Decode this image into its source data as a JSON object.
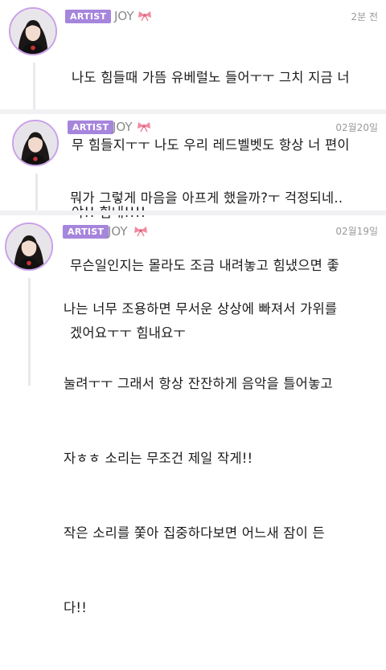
{
  "comments": [
    {
      "badge": "ARTIST",
      "name": "JOY",
      "time": "2분 전",
      "lines": [
        "나도 힘들때 가뜸 유베럴노 들어ㅜㅜ 그치 지금 너",
        "무 힘들지ㅜㅜ 나도 우리 레드벨벳도 항상 너 편이",
        "야!! 힘내!!!!"
      ]
    },
    {
      "badge": "ARTIST",
      "name": "JOY",
      "time": "02월20일",
      "lines": [
        "뭐가 그렇게 마음을 아프게 했을까?ㅜ 걱정되네..",
        "무슨일인지는 몰라도 조금 내려놓고 힘냈으면 좋",
        "겠어요ㅜㅜ 힘내요ㅜ"
      ]
    },
    {
      "badge": "ARTIST",
      "name": "JOY",
      "time": "02월19일",
      "lines": [
        "나는 너무 조용하면 무서운 상상에 빠져서 가위를",
        "눌려ㅜㅜ 그래서 항상 잔잔하게 음악을 틀어놓고",
        "자ㅎㅎ 소리는 무조건 제일 작게!!",
        "작은 소리를 쫓아 집중하다보면 어느새 잠이 든",
        "다!!"
      ]
    }
  ],
  "colors": {
    "badge": "#a685dc",
    "avatar_ring": "#c9a0e8",
    "bow": "#f08aa0",
    "name": "#8a8a8a",
    "time": "#9a9a9a"
  },
  "icons": [
    "avatar",
    "bow-icon"
  ]
}
